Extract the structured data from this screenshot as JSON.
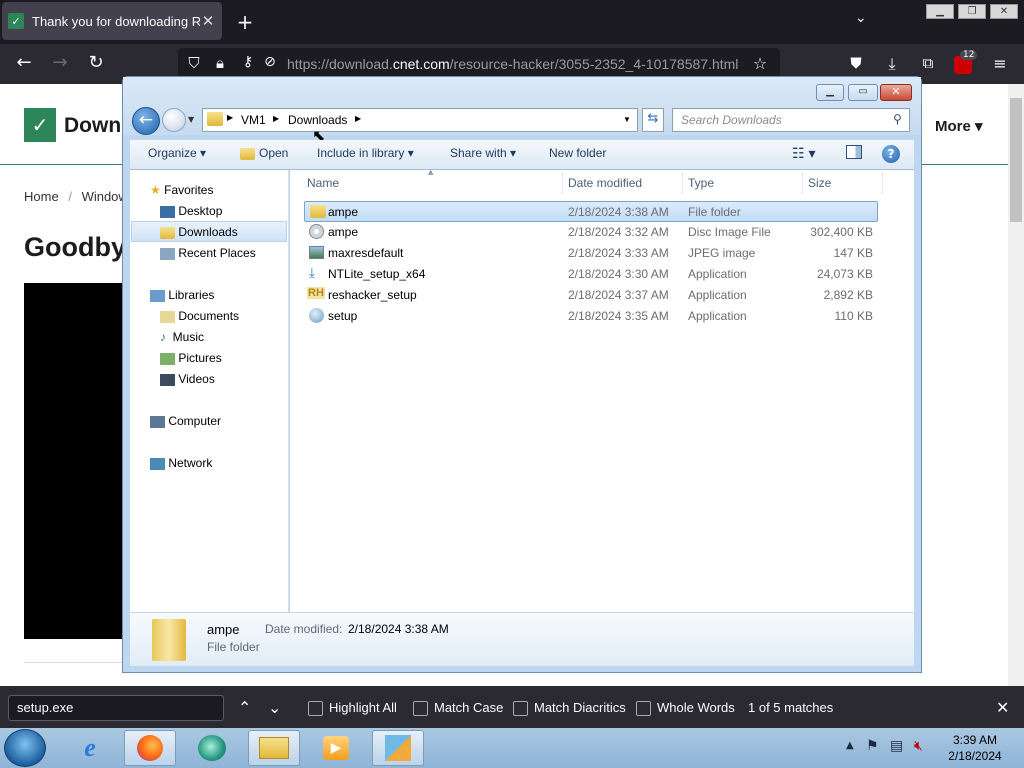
{
  "browser": {
    "tab_title": "Thank you for downloading Re",
    "tab_icon": "cnet-download-icon",
    "url_prefix": "https://download.",
    "url_domain": "cnet.com",
    "url_path": "/resource-hacker/3055-2352_4-10178587.html",
    "extensions_badge": "12"
  },
  "webpage": {
    "logo_text": "Down",
    "more_label": "More",
    "breadcrumb": [
      "Home",
      "/",
      "Windows"
    ],
    "headline": "Goodby"
  },
  "explorer": {
    "address": [
      "VM1",
      "Downloads"
    ],
    "search_placeholder": "Search Downloads",
    "commands": [
      "Organize",
      "Open",
      "Include in library",
      "Share with",
      "New folder"
    ],
    "favorites_label": "Favorites",
    "favorites": [
      "Desktop",
      "Downloads",
      "Recent Places"
    ],
    "libraries_label": "Libraries",
    "libraries": [
      "Documents",
      "Music",
      "Pictures",
      "Videos"
    ],
    "computer_label": "Computer",
    "network_label": "Network",
    "columns": [
      "Name",
      "Date modified",
      "Type",
      "Size"
    ],
    "files": [
      {
        "name": "ampe",
        "date": "2/18/2024 3:38 AM",
        "type": "File folder",
        "size": "",
        "icon": "folder-icon",
        "selected": true
      },
      {
        "name": "ampe",
        "date": "2/18/2024 3:32 AM",
        "type": "Disc Image File",
        "size": "302,400 KB",
        "icon": "disc-image-icon",
        "selected": false
      },
      {
        "name": "maxresdefault",
        "date": "2/18/2024 3:33 AM",
        "type": "JPEG image",
        "size": "147 KB",
        "icon": "image-icon",
        "selected": false
      },
      {
        "name": "NTLite_setup_x64",
        "date": "2/18/2024 3:30 AM",
        "type": "Application",
        "size": "24,073 KB",
        "icon": "installer-icon",
        "selected": false
      },
      {
        "name": "reshacker_setup",
        "date": "2/18/2024 3:37 AM",
        "type": "Application",
        "size": "2,892 KB",
        "icon": "reshacker-icon",
        "selected": false
      },
      {
        "name": "setup",
        "date": "2/18/2024 3:35 AM",
        "type": "Application",
        "size": "110 KB",
        "icon": "setup-icon",
        "selected": false
      }
    ],
    "details": {
      "name": "ampe",
      "date_label": "Date modified:",
      "date": "2/18/2024 3:38 AM",
      "type": "File folder"
    }
  },
  "findbar": {
    "query": "setup.exe",
    "options": [
      "Highlight All",
      "Match Case",
      "Match Diacritics",
      "Whole Words"
    ],
    "matches": "1 of 5 matches"
  },
  "taskbar": {
    "time": "3:39 AM",
    "date": "2/18/2024"
  },
  "colors": {
    "firefox_dark": "#1c1b22",
    "cnet_green": "#2d8659",
    "selection": "#cce4fc"
  }
}
